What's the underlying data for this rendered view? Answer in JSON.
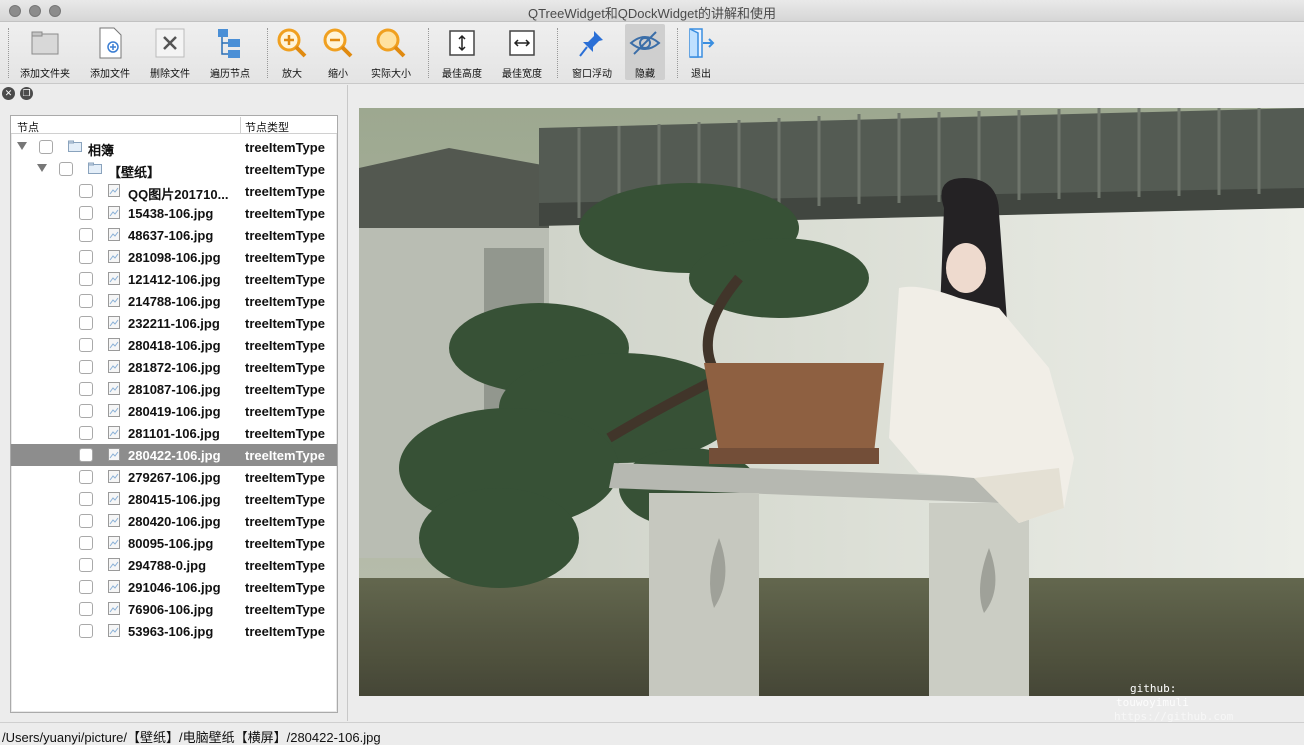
{
  "window": {
    "title": "QTreeWidget和QDockWidget的讲解和使用"
  },
  "toolbar": {
    "buttons": [
      {
        "label": "添加文件夹",
        "icon": "folder-icon"
      },
      {
        "label": "添加文件",
        "icon": "add-file-icon"
      },
      {
        "label": "删除文件",
        "icon": "delete-icon"
      },
      {
        "label": "遍历节点",
        "icon": "tree-nodes-icon"
      },
      {
        "label": "放大",
        "icon": "zoom-in-icon"
      },
      {
        "label": "缩小",
        "icon": "zoom-out-icon"
      },
      {
        "label": "实际大小",
        "icon": "actual-size-icon"
      },
      {
        "label": "最佳高度",
        "icon": "fit-height-icon"
      },
      {
        "label": "最佳宽度",
        "icon": "fit-width-icon"
      },
      {
        "label": "窗口浮动",
        "icon": "pin-icon"
      },
      {
        "label": "隐藏",
        "icon": "eye-hidden-icon",
        "active": true
      },
      {
        "label": "退出",
        "icon": "exit-icon"
      }
    ]
  },
  "tree": {
    "headers": [
      "节点",
      "节点类型"
    ],
    "rows": [
      {
        "name": "相簿",
        "type": "treeItemType",
        "level": 0,
        "expanded": true,
        "kind": "folder"
      },
      {
        "name": "【壁纸】",
        "type": "treeItemType",
        "level": 1,
        "expanded": true,
        "kind": "folder"
      },
      {
        "name": "QQ图片201710...",
        "type": "treeItemType",
        "level": 2,
        "kind": "file"
      },
      {
        "name": "15438-106.jpg",
        "type": "treeItemType",
        "level": 2,
        "kind": "file"
      },
      {
        "name": "48637-106.jpg",
        "type": "treeItemType",
        "level": 2,
        "kind": "file"
      },
      {
        "name": "281098-106.jpg",
        "type": "treeItemType",
        "level": 2,
        "kind": "file"
      },
      {
        "name": "121412-106.jpg",
        "type": "treeItemType",
        "level": 2,
        "kind": "file"
      },
      {
        "name": "214788-106.jpg",
        "type": "treeItemType",
        "level": 2,
        "kind": "file"
      },
      {
        "name": "232211-106.jpg",
        "type": "treeItemType",
        "level": 2,
        "kind": "file"
      },
      {
        "name": "280418-106.jpg",
        "type": "treeItemType",
        "level": 2,
        "kind": "file"
      },
      {
        "name": "281872-106.jpg",
        "type": "treeItemType",
        "level": 2,
        "kind": "file"
      },
      {
        "name": "281087-106.jpg",
        "type": "treeItemType",
        "level": 2,
        "kind": "file"
      },
      {
        "name": "280419-106.jpg",
        "type": "treeItemType",
        "level": 2,
        "kind": "file"
      },
      {
        "name": "281101-106.jpg",
        "type": "treeItemType",
        "level": 2,
        "kind": "file"
      },
      {
        "name": "280422-106.jpg",
        "type": "treeItemType",
        "level": 2,
        "kind": "file",
        "selected": true
      },
      {
        "name": "279267-106.jpg",
        "type": "treeItemType",
        "level": 2,
        "kind": "file"
      },
      {
        "name": "280415-106.jpg",
        "type": "treeItemType",
        "level": 2,
        "kind": "file"
      },
      {
        "name": "280420-106.jpg",
        "type": "treeItemType",
        "level": 2,
        "kind": "file"
      },
      {
        "name": "80095-106.jpg",
        "type": "treeItemType",
        "level": 2,
        "kind": "file"
      },
      {
        "name": "294788-0.jpg",
        "type": "treeItemType",
        "level": 2,
        "kind": "file"
      },
      {
        "name": "291046-106.jpg",
        "type": "treeItemType",
        "level": 2,
        "kind": "file"
      },
      {
        "name": "76906-106.jpg",
        "type": "treeItemType",
        "level": 2,
        "kind": "file"
      },
      {
        "name": "53963-106.jpg",
        "type": "treeItemType",
        "level": 2,
        "kind": "file"
      }
    ]
  },
  "watermark": {
    "line1": "github:",
    "line2": "touwoyimuli",
    "line3": "https://github.com"
  },
  "status": {
    "path": "/Users/yuanyi/picture/【壁纸】/电脑壁纸【横屏】/280422-106.jpg"
  },
  "colors": {
    "selection": "#8d8d8d",
    "zoom_accent": "#f0a020",
    "pin_blue": "#2a6fd6",
    "folder_blue": "#4a8fd6"
  }
}
